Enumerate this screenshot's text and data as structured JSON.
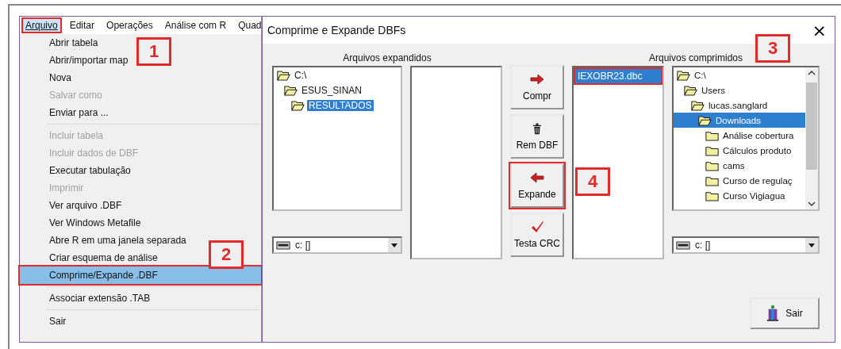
{
  "menubar": [
    {
      "label": "Arquivo",
      "selected": true,
      "outlined": true
    },
    {
      "label": "Editar",
      "selected": false,
      "outlined": false
    },
    {
      "label": "Operações",
      "selected": false,
      "outlined": false
    },
    {
      "label": "Análise com R",
      "selected": false,
      "outlined": false
    },
    {
      "label": "Quad",
      "selected": false,
      "outlined": false
    }
  ],
  "menu": [
    {
      "kind": "item",
      "label": "Abrir tabela",
      "disabled": false,
      "selected": false,
      "outlined": false
    },
    {
      "kind": "item",
      "label": "Abrir/importar map",
      "disabled": false,
      "selected": false,
      "outlined": false
    },
    {
      "kind": "item",
      "label": "Nova",
      "disabled": false,
      "selected": false,
      "outlined": false
    },
    {
      "kind": "item",
      "label": "Salvar como",
      "disabled": true,
      "selected": false,
      "outlined": false
    },
    {
      "kind": "item",
      "label": "Enviar para ...",
      "disabled": false,
      "selected": false,
      "outlined": false
    },
    {
      "kind": "separator"
    },
    {
      "kind": "item",
      "label": "Incluir tabela",
      "disabled": true,
      "selected": false,
      "outlined": false
    },
    {
      "kind": "item",
      "label": "Incluir dados de DBF",
      "disabled": true,
      "selected": false,
      "outlined": false
    },
    {
      "kind": "item",
      "label": "Executar tabulação",
      "disabled": false,
      "selected": false,
      "outlined": false
    },
    {
      "kind": "item",
      "label": "Imprimir",
      "disabled": true,
      "selected": false,
      "outlined": false
    },
    {
      "kind": "item",
      "label": "Ver arquivo .DBF",
      "disabled": false,
      "selected": false,
      "outlined": false
    },
    {
      "kind": "item",
      "label": "Ver Windows Metafile",
      "disabled": false,
      "selected": false,
      "outlined": false
    },
    {
      "kind": "item",
      "label": "Abre R em uma janela separada",
      "disabled": false,
      "selected": false,
      "outlined": false
    },
    {
      "kind": "item",
      "label": "Criar esquema de análise",
      "disabled": false,
      "selected": false,
      "outlined": false
    },
    {
      "kind": "item",
      "label": "Comprime/Expande .DBF",
      "disabled": false,
      "selected": true,
      "outlined": true
    },
    {
      "kind": "separator"
    },
    {
      "kind": "item",
      "label": "Associar extensão .TAB",
      "disabled": false,
      "selected": false,
      "outlined": false
    },
    {
      "kind": "separator"
    },
    {
      "kind": "item",
      "label": "Sair",
      "disabled": false,
      "selected": false,
      "outlined": false
    }
  ],
  "dialog": {
    "title": "Comprime e Expande DBFs",
    "close": "×",
    "expanded": {
      "label": "Arquivos expandidos",
      "tree": [
        {
          "label": "C:\\",
          "selected": false,
          "children": [
            {
              "label": "ESUS_SINAN",
              "selected": false,
              "children": [
                {
                  "label": "RESULTADOS",
                  "selected": true
                }
              ]
            }
          ]
        }
      ],
      "drive": "c: []"
    },
    "buttons": [
      {
        "kind": "compress",
        "label": "Compr",
        "outlined": false
      },
      {
        "kind": "remove",
        "label": "Rem DBF",
        "outlined": false
      },
      {
        "kind": "expand",
        "label": "Expande",
        "outlined": true
      },
      {
        "kind": "test",
        "label": "Testa CRC",
        "outlined": false
      }
    ],
    "compressed": {
      "label": "Arquivos comprimidos",
      "files": [
        {
          "label": "IEXOBR23.dbc",
          "selected": true,
          "outlined": true
        }
      ],
      "drive": "c: []",
      "tree": [
        {
          "label": "C:\\",
          "selected": false,
          "children": [
            {
              "label": "Users",
              "selected": false,
              "children": [
                {
                  "label": "lucas.sanglard",
                  "selected": false,
                  "children": [
                    {
                      "label": "Downloads",
                      "selected": true,
                      "children": [
                        {
                          "label": "Análise cobertura",
                          "selected": false
                        },
                        {
                          "label": "Cálculos produto",
                          "selected": false
                        },
                        {
                          "label": "cams",
                          "selected": false
                        },
                        {
                          "label": "Curso de regulaç",
                          "selected": false
                        },
                        {
                          "label": "Curso Vigiagua",
                          "selected": false
                        }
                      ]
                    }
                  ]
                }
              ]
            }
          ]
        }
      ]
    },
    "exit": "Sair"
  },
  "callouts": [
    "1",
    "2",
    "3",
    "4"
  ]
}
